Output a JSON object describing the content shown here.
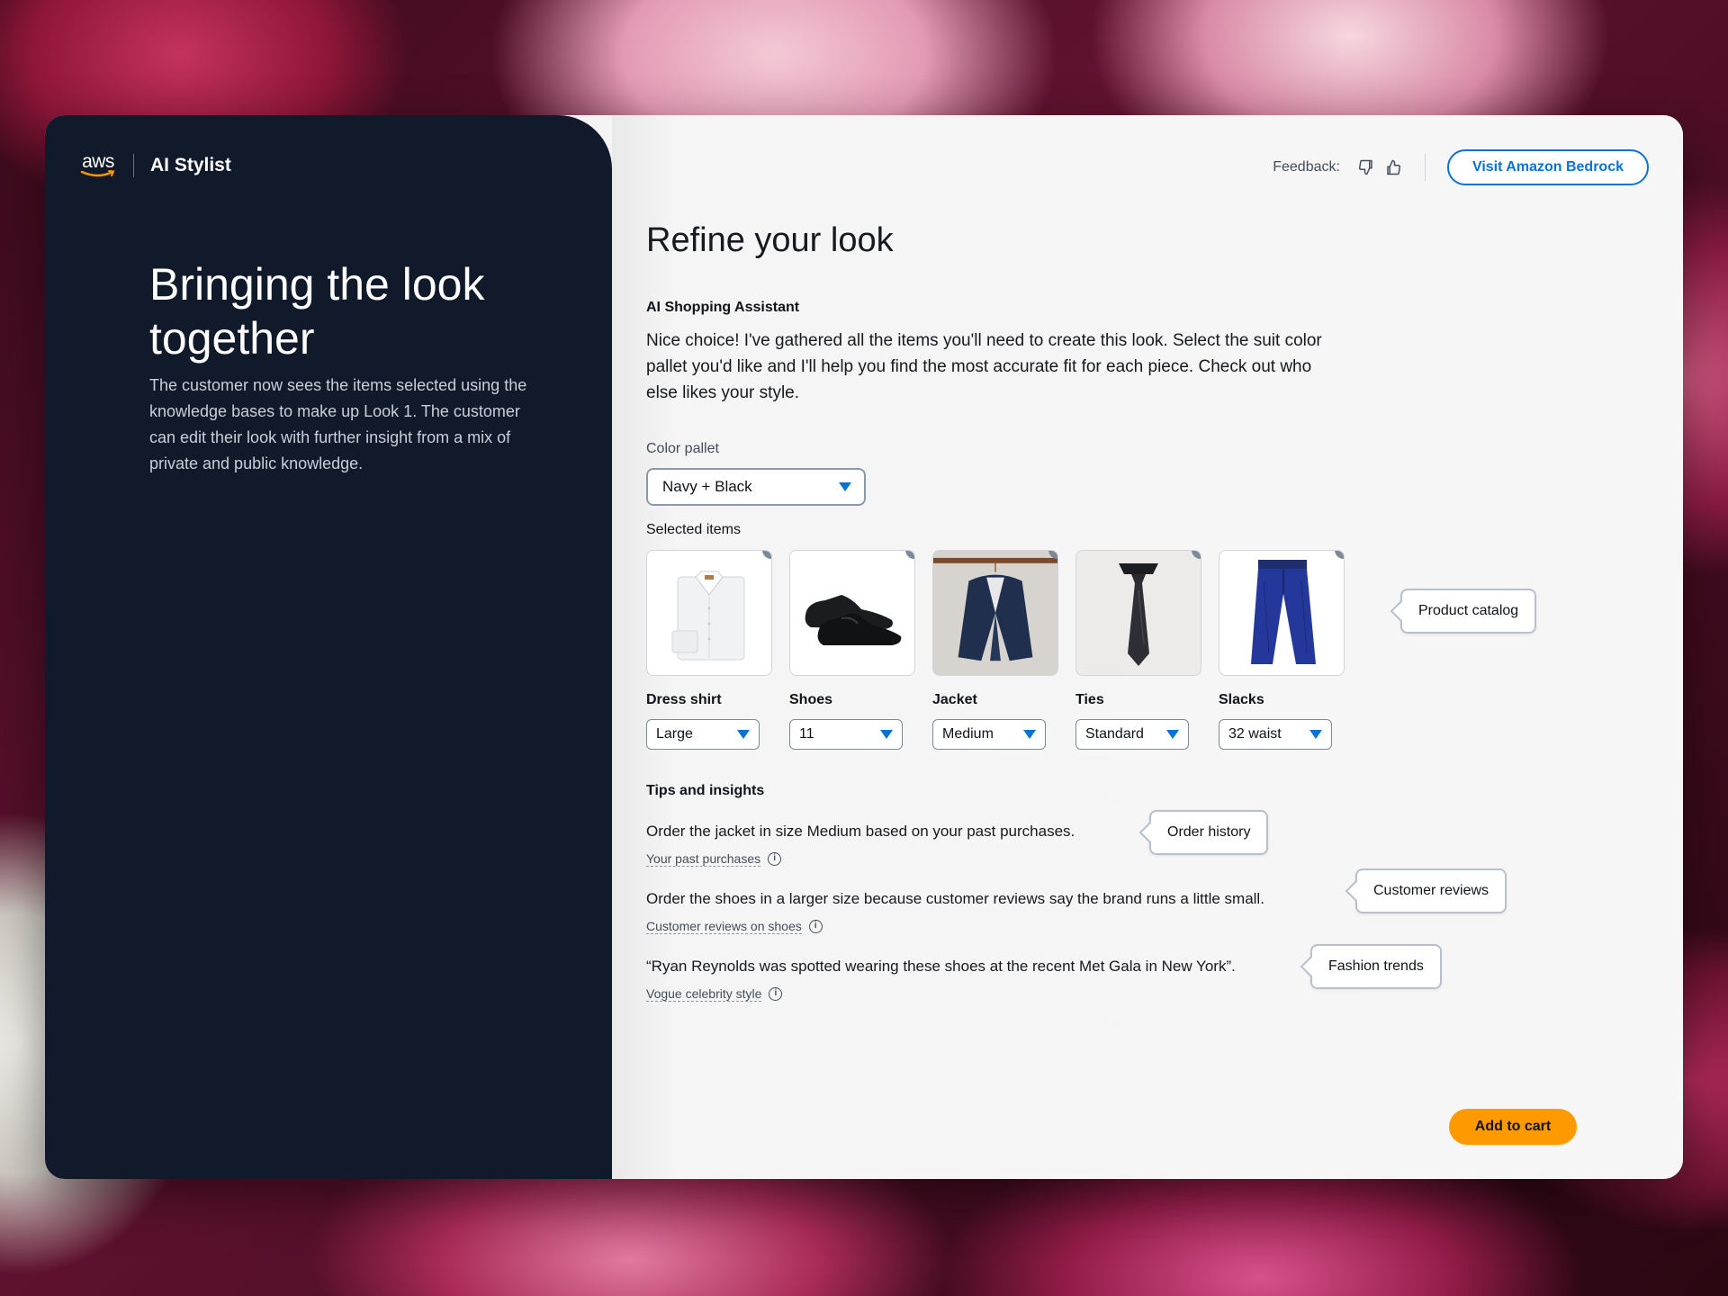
{
  "brand": {
    "logo_text": "aws",
    "product": "AI Stylist"
  },
  "hero": {
    "title": "Bringing the look together",
    "description": "The customer now sees the items selected using the knowledge bases to make up Look 1. The customer can edit their look with further insight from a mix of private and public knowledge."
  },
  "topbar": {
    "feedback_label": "Feedback:",
    "bedrock_button": "Visit Amazon Bedrock"
  },
  "page_title": "Refine your look",
  "assistant": {
    "label": "AI Shopping Assistant",
    "message": "Nice choice! I've gathered all the items you'll need to create this look. Select the suit color pallet you'd like and I'll help you find the most accurate fit for each piece. Check out who else likes your style."
  },
  "color_pallet": {
    "label": "Color pallet",
    "value": "Navy + Black"
  },
  "selected_items": {
    "label": "Selected items",
    "items": [
      {
        "name": "Dress shirt",
        "size": "Large",
        "icon": "dress-shirt"
      },
      {
        "name": "Shoes",
        "size": "11",
        "icon": "oxford-shoes"
      },
      {
        "name": "Jacket",
        "size": "Medium",
        "icon": "navy-jacket"
      },
      {
        "name": "Ties",
        "size": "Standard",
        "icon": "black-tie"
      },
      {
        "name": "Slacks",
        "size": "32 waist",
        "icon": "navy-slacks"
      }
    ]
  },
  "callouts": {
    "product_catalog": "Product catalog",
    "order_history": "Order history",
    "customer_reviews": "Customer reviews",
    "fashion_trends": "Fashion trends"
  },
  "tips": {
    "title": "Tips and insights",
    "items": [
      {
        "text": "Order the jacket in size Medium based on your past purchases.",
        "source": "Your past purchases"
      },
      {
        "text": "Order the shoes in a larger size because customer reviews say the brand runs a little small.",
        "source": "Customer reviews on shoes"
      },
      {
        "text": "“Ryan Reynolds was spotted wearing these shoes at the recent Met Gala in New York”.",
        "source": "Vogue celebrity style"
      }
    ]
  },
  "cart_button": "Add to cart",
  "colors": {
    "accent": "#0972d3",
    "cart": "#ff9900",
    "panel": "#101a2b"
  }
}
